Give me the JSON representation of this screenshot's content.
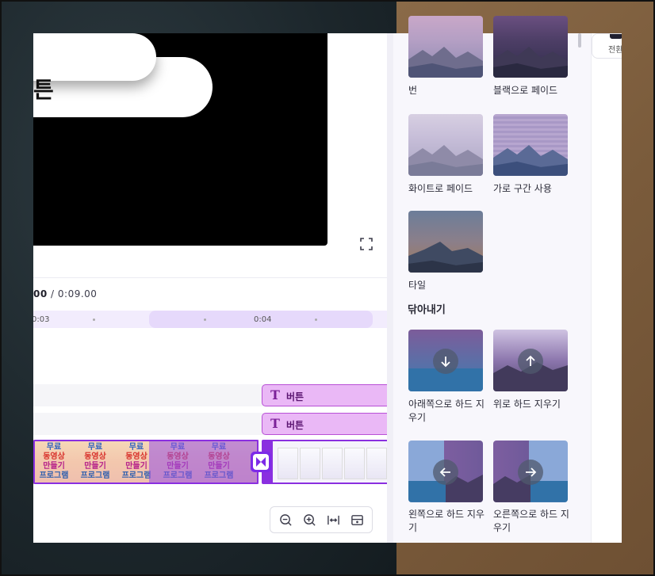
{
  "preview": {
    "text_fragment": "튼",
    "fullscreen_icon": "fullscreen-icon"
  },
  "timeline": {
    "current_time": "00",
    "total_time": "/ 0:09.00",
    "ruler_labels": [
      "0:03",
      "0:04"
    ],
    "text_tracks": [
      {
        "icon": "T",
        "label": "버튼"
      },
      {
        "icon": "T",
        "label": "버튼"
      }
    ],
    "video_clip_text": [
      "무료",
      "동영상",
      "만들기",
      "프로그램"
    ]
  },
  "zoom_controls": [
    "zoom-out-icon",
    "zoom-in-icon",
    "fit-width-icon",
    "fit-screen-icon"
  ],
  "panel": {
    "items": [
      {
        "label": "번"
      },
      {
        "label": "블랙으로 페이드"
      },
      {
        "label": "화이트로 페이드"
      },
      {
        "label": "가로 구간 사용"
      },
      {
        "label": "타일"
      }
    ],
    "wipe_section_title": "닦아내기",
    "wipe_items": [
      {
        "label": "아래쪽으로 하드 지우기",
        "icon": "arrow-down-icon"
      },
      {
        "label": "위로 하드 지우기",
        "icon": "arrow-up-icon"
      },
      {
        "label": "왼쪽으로 하드 지우기",
        "icon": "arrow-left-icon"
      },
      {
        "label": "오른쪽으로 하드 지우기",
        "icon": "arrow-right-icon"
      }
    ]
  },
  "rail": {
    "label": "전환"
  },
  "colors": {
    "accent": "#7d2ae8",
    "text_clip": "#eab8f6"
  }
}
